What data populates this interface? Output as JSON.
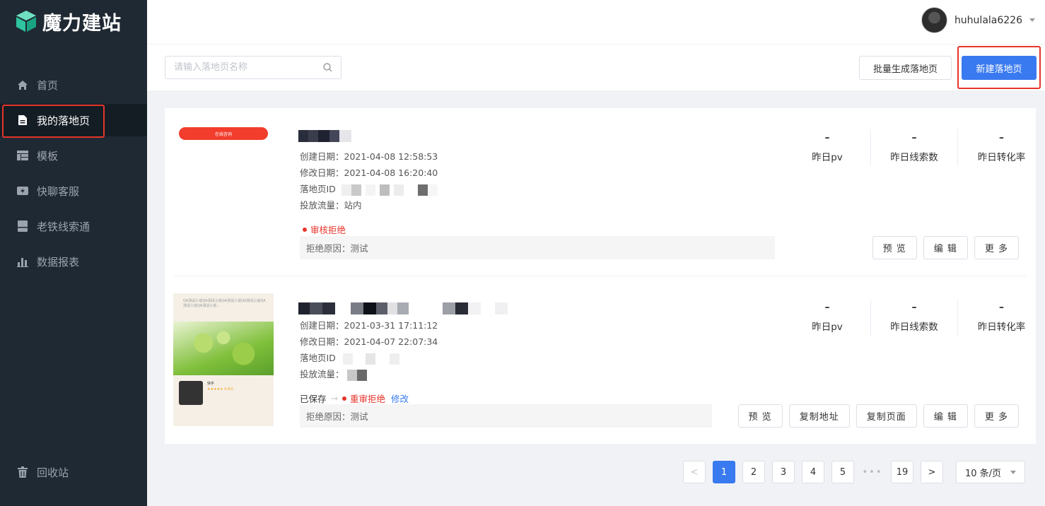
{
  "app": {
    "logo_text": "魔力建站",
    "brand_color": "#3a7af0",
    "danger_color": "#e6352b"
  },
  "header": {
    "username": "huhulala6226"
  },
  "sidebar": {
    "items": [
      {
        "label": "首页",
        "icon": "home-icon"
      },
      {
        "label": "我的落地页",
        "icon": "document-icon",
        "active": true
      },
      {
        "label": "模板",
        "icon": "template-icon"
      },
      {
        "label": "快聊客服",
        "icon": "chat-icon"
      },
      {
        "label": "老铁线索通",
        "icon": "clue-icon"
      },
      {
        "label": "数据报表",
        "icon": "chart-icon"
      }
    ],
    "trash": {
      "label": "回收站",
      "icon": "trash-icon"
    }
  },
  "toolbar": {
    "search_placeholder": "请输入落地页名称",
    "batch_label": "批量生成落地页",
    "new_label": "新建落地页"
  },
  "pages": [
    {
      "thumb_text": "在线咨询",
      "created": "创建日期：2021-04-08 12:58:53",
      "modified": "修改日期：2021-04-08 16:20:40",
      "id_label": "落地页ID",
      "traffic": "投放流量：站内",
      "status": "审核拒绝",
      "reason": "拒绝原因：测试",
      "stats": [
        {
          "value": "–",
          "label": "昨日pv"
        },
        {
          "value": "–",
          "label": "昨日线索数"
        },
        {
          "value": "–",
          "label": "昨日转化率"
        }
      ],
      "actions": [
        "预 览",
        "编 辑",
        "更 多"
      ]
    },
    {
      "thumb_head": "QA测试小说QA测试小说QA测试小说QA测试小说QA测试小说QA测试小说...",
      "thumb_app_name": "快手",
      "thumb_rating": "★★★★★ 4.9分",
      "created": "创建日期：2021-03-31 17:11:12",
      "modified": "修改日期：2021-04-07 22:07:34",
      "id_label": "落地页ID",
      "traffic": "投放流量：",
      "saved": "已保存",
      "status": "重审拒绝",
      "edit_link": "修改",
      "reason": "拒绝原因：测试",
      "stats": [
        {
          "value": "–",
          "label": "昨日pv"
        },
        {
          "value": "–",
          "label": "昨日线索数"
        },
        {
          "value": "–",
          "label": "昨日转化率"
        }
      ],
      "actions": [
        "预 览",
        "复制地址",
        "复制页面",
        "编 辑",
        "更 多"
      ]
    }
  ],
  "pagination": {
    "prev": "<",
    "pages": [
      "1",
      "2",
      "3",
      "4",
      "5"
    ],
    "ellipsis": "•••",
    "last": "19",
    "next": ">",
    "page_size": "10 条/页",
    "current": "1"
  }
}
